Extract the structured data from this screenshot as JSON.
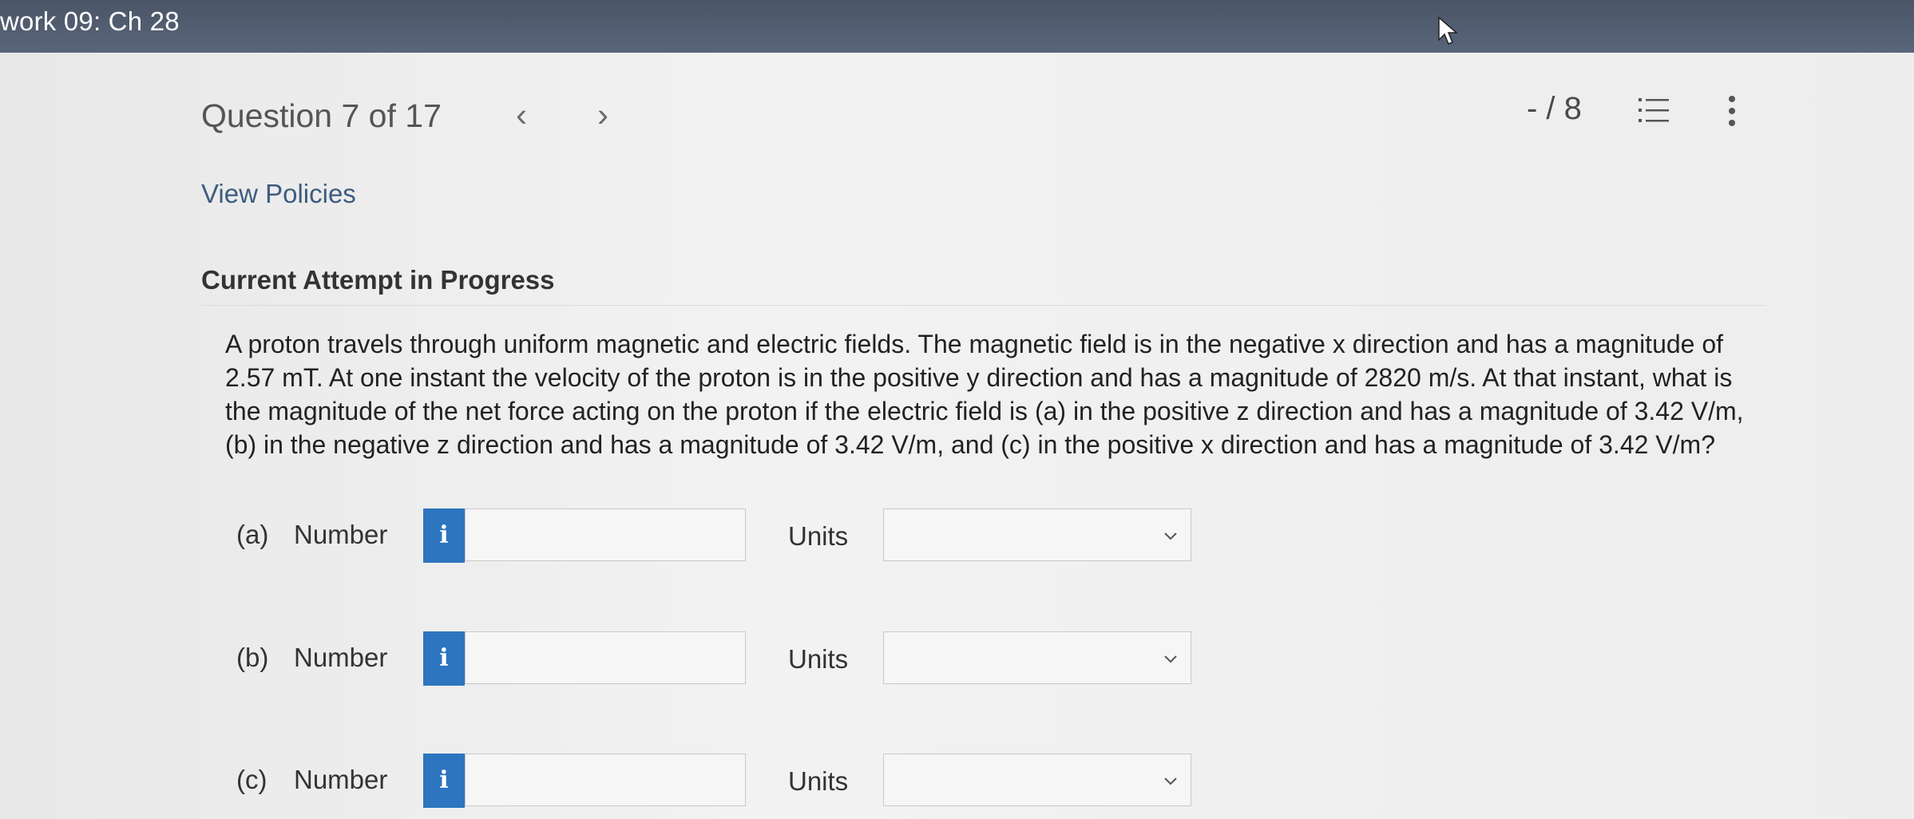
{
  "header": {
    "title": "work 09: Ch 28"
  },
  "question_nav": {
    "label": "Question 7 of 17",
    "prev_icon": "chevron-left-icon",
    "next_icon": "chevron-right-icon",
    "score": "- / 8",
    "list_icon": "list-icon",
    "more_icon": "more-vertical-icon"
  },
  "links": {
    "view_policies": "View Policies"
  },
  "attempt": {
    "title": "Current Attempt in Progress"
  },
  "question": {
    "lines": [
      "A proton travels through uniform magnetic and electric fields. The magnetic field is in the negative x direction and has a magnitude of",
      "2.57 mT. At one instant the velocity of the proton is in the positive y direction and has a magnitude of 2820 m/s. At that instant, what is",
      "the magnitude of the net force acting on the proton if the electric field is (a) in the positive z direction and has a magnitude of 3.42 V/m,",
      "(b) in the negative z direction and has a magnitude of 3.42 V/m, and (c) in the positive x direction and has a magnitude of 3.42 V/m?"
    ]
  },
  "answers": [
    {
      "part": "(a)",
      "number_label": "Number",
      "info": "i",
      "number_value": "",
      "units_label": "Units",
      "units_value": ""
    },
    {
      "part": "(b)",
      "number_label": "Number",
      "info": "i",
      "number_value": "",
      "units_label": "Units",
      "units_value": ""
    },
    {
      "part": "(c)",
      "number_label": "Number",
      "info": "i",
      "number_value": "",
      "units_label": "Units",
      "units_value": ""
    }
  ],
  "colors": {
    "topbar": "#4f5a6c",
    "info_button": "#2d75bf",
    "link": "#3d5c80"
  }
}
